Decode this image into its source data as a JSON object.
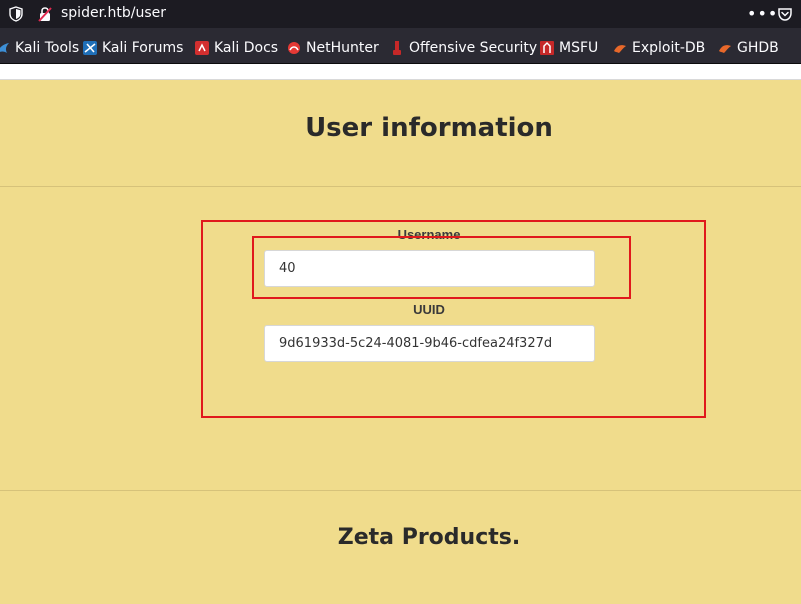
{
  "browser": {
    "url": "spider.htb/user",
    "menu_glyph": "•••",
    "bookmarks": [
      {
        "label": "Kali Tools",
        "icon": "kali-dragon-icon",
        "color": "#3d8fd6"
      },
      {
        "label": "Kali Forums",
        "icon": "kali-forums-icon",
        "color": "#3d8fd6"
      },
      {
        "label": "Kali Docs",
        "icon": "kali-docs-icon",
        "color": "#d32f2f"
      },
      {
        "label": "NetHunter",
        "icon": "nethunter-icon",
        "color": "#e53935"
      },
      {
        "label": "Offensive Security",
        "icon": "offsec-icon",
        "color": "#c62828"
      },
      {
        "label": "MSFU",
        "icon": "msfu-icon",
        "color": "#c62828"
      },
      {
        "label": "Exploit-DB",
        "icon": "exploit-db-icon",
        "color": "#e8682a"
      },
      {
        "label": "GHDB",
        "icon": "ghdb-icon",
        "color": "#e8682a"
      }
    ]
  },
  "page": {
    "title": "User information",
    "username_label": "Username",
    "username_value": "40",
    "uuid_label": "UUID",
    "uuid_value": "9d61933d-5c24-4081-9b46-cdfea24f327d",
    "footer_title": "Zeta Products."
  },
  "colors": {
    "page_background": "#f0dc8c",
    "annotation": "#e0191c"
  }
}
